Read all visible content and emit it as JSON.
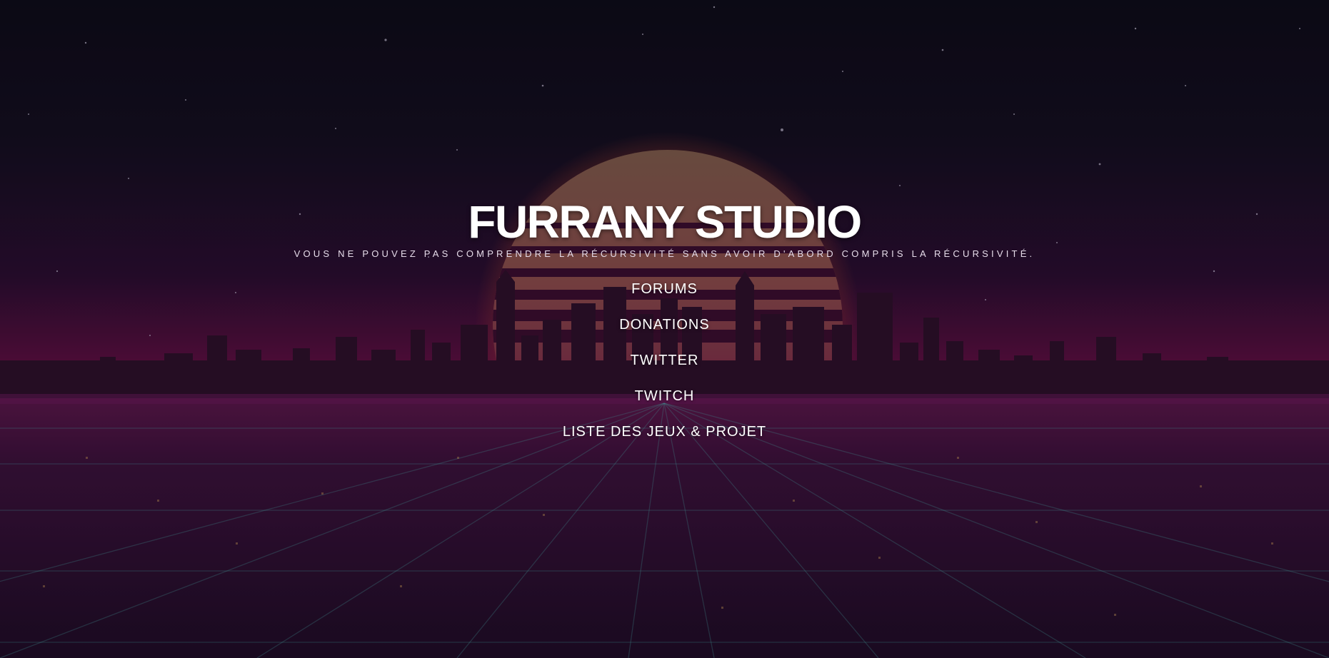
{
  "site": {
    "title": "FURRANY STUDIO",
    "tagline": "Vous ne pouvez pas comprendre la récursivité sans avoir d'abord compris la récursivité."
  },
  "nav": {
    "items": [
      {
        "label": "FORUMS"
      },
      {
        "label": "DONATIONS"
      },
      {
        "label": "TWITTER"
      },
      {
        "label": "TWITCH"
      },
      {
        "label": "LISTE DES JEUX & PROJET"
      }
    ]
  },
  "colors": {
    "sky_top": "#0d0b16",
    "sky_mid": "#2a0d2e",
    "horizon": "#6e0f45",
    "sun": "#b08a52",
    "ground": "#2a1030",
    "grid_line": "#4fb3b0",
    "text": "#ffffff"
  },
  "background": {
    "description_icon": "synthwave-city-background"
  }
}
